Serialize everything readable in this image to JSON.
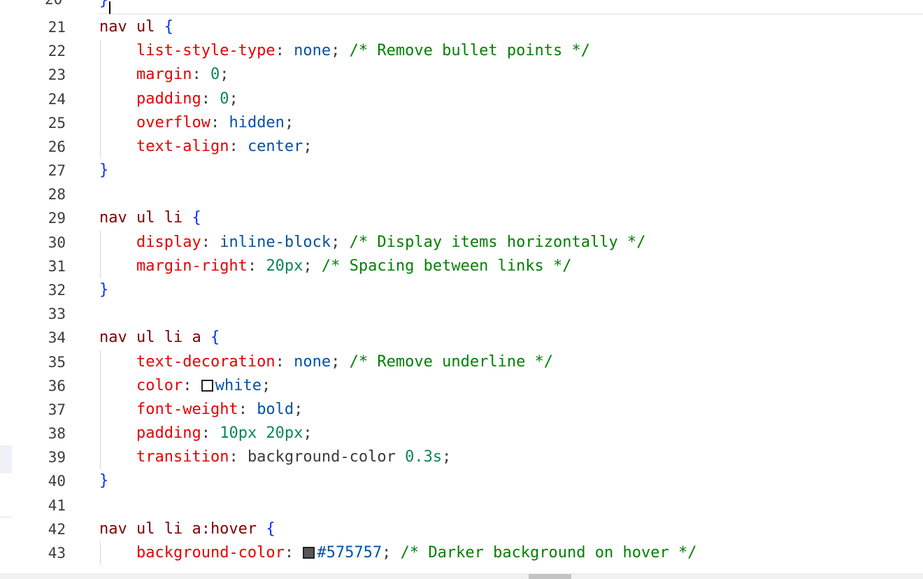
{
  "editor": {
    "partial_top_line_number": "20",
    "partial_top_code": "}",
    "lines": [
      {
        "n": "21",
        "tokens": [
          {
            "t": "nav ul",
            "c": "sel"
          },
          {
            "t": " ",
            "c": "plain"
          },
          {
            "t": "{",
            "c": "brace"
          }
        ]
      },
      {
        "n": "22",
        "tokens": [
          {
            "t": "    ",
            "c": "plain"
          },
          {
            "t": "list-style-type",
            "c": "prop"
          },
          {
            "t": ": ",
            "c": "punc"
          },
          {
            "t": "none",
            "c": "kw"
          },
          {
            "t": "; ",
            "c": "punc"
          },
          {
            "t": "/* Remove bullet points */",
            "c": "cmt"
          }
        ]
      },
      {
        "n": "23",
        "tokens": [
          {
            "t": "    ",
            "c": "plain"
          },
          {
            "t": "margin",
            "c": "prop"
          },
          {
            "t": ": ",
            "c": "punc"
          },
          {
            "t": "0",
            "c": "num"
          },
          {
            "t": ";",
            "c": "punc"
          }
        ]
      },
      {
        "n": "24",
        "tokens": [
          {
            "t": "    ",
            "c": "plain"
          },
          {
            "t": "padding",
            "c": "prop"
          },
          {
            "t": ": ",
            "c": "punc"
          },
          {
            "t": "0",
            "c": "num"
          },
          {
            "t": ";",
            "c": "punc"
          }
        ]
      },
      {
        "n": "25",
        "tokens": [
          {
            "t": "    ",
            "c": "plain"
          },
          {
            "t": "overflow",
            "c": "prop"
          },
          {
            "t": ": ",
            "c": "punc"
          },
          {
            "t": "hidden",
            "c": "kw"
          },
          {
            "t": ";",
            "c": "punc"
          }
        ]
      },
      {
        "n": "26",
        "tokens": [
          {
            "t": "    ",
            "c": "plain"
          },
          {
            "t": "text-align",
            "c": "prop"
          },
          {
            "t": ": ",
            "c": "punc"
          },
          {
            "t": "center",
            "c": "kw"
          },
          {
            "t": ";",
            "c": "punc"
          }
        ]
      },
      {
        "n": "27",
        "tokens": [
          {
            "t": "}",
            "c": "brace"
          }
        ]
      },
      {
        "n": "28",
        "tokens": []
      },
      {
        "n": "29",
        "tokens": [
          {
            "t": "nav ul li",
            "c": "sel"
          },
          {
            "t": " ",
            "c": "plain"
          },
          {
            "t": "{",
            "c": "brace"
          }
        ]
      },
      {
        "n": "30",
        "tokens": [
          {
            "t": "    ",
            "c": "plain"
          },
          {
            "t": "display",
            "c": "prop"
          },
          {
            "t": ": ",
            "c": "punc"
          },
          {
            "t": "inline-block",
            "c": "kw"
          },
          {
            "t": "; ",
            "c": "punc"
          },
          {
            "t": "/* Display items horizontally */",
            "c": "cmt"
          }
        ]
      },
      {
        "n": "31",
        "tokens": [
          {
            "t": "    ",
            "c": "plain"
          },
          {
            "t": "margin-right",
            "c": "prop"
          },
          {
            "t": ": ",
            "c": "punc"
          },
          {
            "t": "20px",
            "c": "num"
          },
          {
            "t": "; ",
            "c": "punc"
          },
          {
            "t": "/* Spacing between links */",
            "c": "cmt"
          }
        ]
      },
      {
        "n": "32",
        "tokens": [
          {
            "t": "}",
            "c": "brace"
          }
        ]
      },
      {
        "n": "33",
        "tokens": []
      },
      {
        "n": "34",
        "tokens": [
          {
            "t": "nav ul li a",
            "c": "sel"
          },
          {
            "t": " ",
            "c": "plain"
          },
          {
            "t": "{",
            "c": "brace"
          }
        ]
      },
      {
        "n": "35",
        "tokens": [
          {
            "t": "    ",
            "c": "plain"
          },
          {
            "t": "text-decoration",
            "c": "prop"
          },
          {
            "t": ": ",
            "c": "punc"
          },
          {
            "t": "none",
            "c": "kw"
          },
          {
            "t": "; ",
            "c": "punc"
          },
          {
            "t": "/* Remove underline */",
            "c": "cmt"
          }
        ]
      },
      {
        "n": "36",
        "tokens": [
          {
            "t": "    ",
            "c": "plain"
          },
          {
            "t": "color",
            "c": "prop"
          },
          {
            "t": ": ",
            "c": "punc"
          },
          {
            "t": "",
            "c": "swatch",
            "color": "#ffffff"
          },
          {
            "t": "white",
            "c": "kw"
          },
          {
            "t": ";",
            "c": "punc"
          }
        ]
      },
      {
        "n": "37",
        "tokens": [
          {
            "t": "    ",
            "c": "plain"
          },
          {
            "t": "font-weight",
            "c": "prop"
          },
          {
            "t": ": ",
            "c": "punc"
          },
          {
            "t": "bold",
            "c": "kw"
          },
          {
            "t": ";",
            "c": "punc"
          }
        ]
      },
      {
        "n": "38",
        "tokens": [
          {
            "t": "    ",
            "c": "plain"
          },
          {
            "t": "padding",
            "c": "prop"
          },
          {
            "t": ": ",
            "c": "punc"
          },
          {
            "t": "10px 20px",
            "c": "num"
          },
          {
            "t": ";",
            "c": "punc"
          }
        ]
      },
      {
        "n": "39",
        "tokens": [
          {
            "t": "    ",
            "c": "plain"
          },
          {
            "t": "transition",
            "c": "prop"
          },
          {
            "t": ": ",
            "c": "punc"
          },
          {
            "t": "background-color ",
            "c": "plain"
          },
          {
            "t": "0.3s",
            "c": "num"
          },
          {
            "t": ";",
            "c": "punc"
          }
        ]
      },
      {
        "n": "40",
        "tokens": [
          {
            "t": "}",
            "c": "brace"
          }
        ]
      },
      {
        "n": "41",
        "tokens": []
      },
      {
        "n": "42",
        "tokens": [
          {
            "t": "nav ul li a:hover",
            "c": "sel"
          },
          {
            "t": " ",
            "c": "plain"
          },
          {
            "t": "{",
            "c": "brace"
          }
        ]
      },
      {
        "n": "43",
        "tokens": [
          {
            "t": "    ",
            "c": "plain"
          },
          {
            "t": "background-color",
            "c": "prop"
          },
          {
            "t": ": ",
            "c": "punc"
          },
          {
            "t": "",
            "c": "swatch",
            "color": "#575757"
          },
          {
            "t": "#575757",
            "c": "kw"
          },
          {
            "t": "; ",
            "c": "punc"
          },
          {
            "t": "/* Darker background on hover */",
            "c": "cmt"
          }
        ]
      }
    ]
  },
  "colors": {
    "selector": "#800000",
    "brace": "#0431fa",
    "property": "#e50000",
    "keyword": "#0451a5",
    "number": "#098658",
    "comment": "#008000",
    "line_number": "#3b3b3b"
  }
}
